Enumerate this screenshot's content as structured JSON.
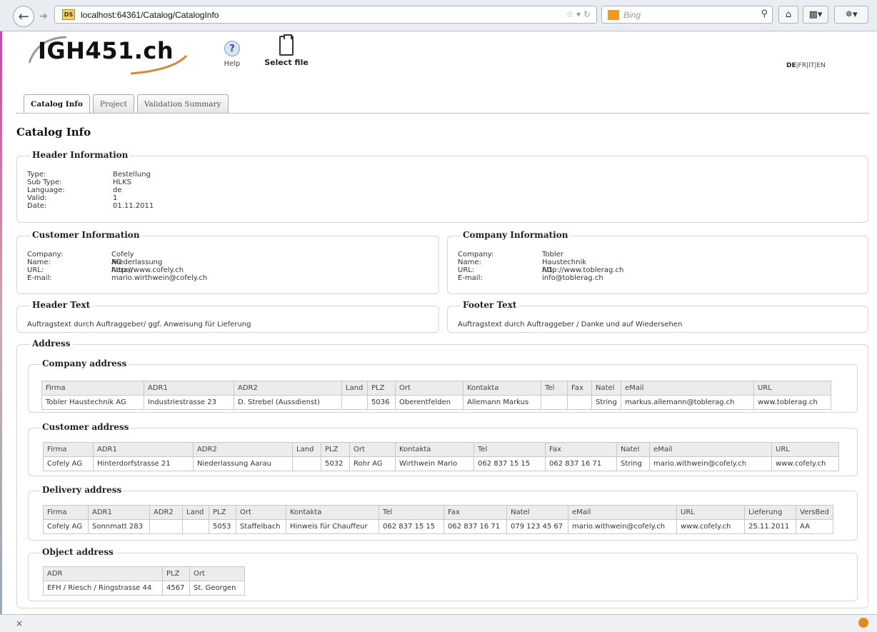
{
  "browser": {
    "url": "localhost:64361/Catalog/CatalogInfo",
    "search_placeholder": "Bing",
    "site_icon_text": "DS",
    "status_close": "×"
  },
  "app": {
    "logo": "IGH451.ch",
    "help_label": "Help",
    "select_file_label": "Select file",
    "languages": [
      "DE",
      "FR",
      "IT",
      "EN"
    ],
    "lang_sep": "|"
  },
  "tabs": [
    {
      "label": "Catalog Info"
    },
    {
      "label": "Project"
    },
    {
      "label": "Validation Summary"
    }
  ],
  "page_title": "Catalog Info",
  "header_info": {
    "title": "Header Information",
    "rows": [
      {
        "k": "Type:",
        "v": "Bestellung"
      },
      {
        "k": "Sub Type:",
        "v": "HLKS"
      },
      {
        "k": "Language:",
        "v": "de"
      },
      {
        "k": "Valid:",
        "v": "1"
      },
      {
        "k": "Date:",
        "v": "01.11.2011"
      }
    ]
  },
  "customer_info": {
    "title": "Customer Information",
    "rows": [
      {
        "k": "Company:",
        "v": "Cofely AG"
      },
      {
        "k": "Name:",
        "v": "Niederlassung Aarau"
      },
      {
        "k": "URL:",
        "v": "http://www.cofely.ch"
      },
      {
        "k": "E-mail:",
        "v": "mario.wirthwein@cofely.ch"
      }
    ]
  },
  "company_info": {
    "title": "Company Information",
    "rows": [
      {
        "k": "Company:",
        "v": "Tobler Haustechnik AG"
      },
      {
        "k": "Name:",
        "v": ""
      },
      {
        "k": "URL:",
        "v": "http://www.toblerag.ch"
      },
      {
        "k": "E-mail:",
        "v": "info@toblerag.ch"
      }
    ]
  },
  "header_text": {
    "title": "Header Text",
    "text": "Auftragstext durch Auftraggeber/ ggf. Anweisung für Lieferung"
  },
  "footer_text": {
    "title": "Footer Text",
    "text": "Auftragstext durch Auftraggeber / Danke und auf Wiedersehen"
  },
  "address": {
    "title": "Address",
    "company": {
      "title": "Company address",
      "headers": [
        "Firma",
        "ADR1",
        "ADR2",
        "Land",
        "PLZ",
        "Ort",
        "Kontakta",
        "Tel",
        "Fax",
        "Natel",
        "eMail",
        "URL"
      ],
      "rows": [
        [
          "Tobler Haustechnik AG",
          "Industriestrasse 23",
          "D. Strebel (Aussdienst)",
          "",
          "5036",
          "Oberentfelden",
          "Allemann Markus",
          "",
          "",
          "String",
          "markus.allemann@toblerag.ch",
          "www.toblerag.ch"
        ]
      ]
    },
    "customer": {
      "title": "Customer address",
      "headers": [
        "Firma",
        "ADR1",
        "ADR2",
        "Land",
        "PLZ",
        "Ort",
        "Kontakta",
        "Tel",
        "Fax",
        "Natel",
        "eMail",
        "URL"
      ],
      "rows": [
        [
          "Cofely AG",
          "Hinterdorfstrasse 21",
          "Niederlassung Aarau",
          "",
          "5032",
          "Rohr AG",
          "Wirthwein Mario",
          "062 837 15 15",
          "062 837 16 71",
          "String",
          "mario.withwein@cofely.ch",
          "www.cofely.ch"
        ]
      ]
    },
    "delivery": {
      "title": "Delivery address",
      "headers": [
        "Firma",
        "ADR1",
        "ADR2",
        "Land",
        "PLZ",
        "Ort",
        "Kontakta",
        "Tel",
        "Fax",
        "Natel",
        "eMail",
        "URL",
        "Lieferung",
        "VersBed"
      ],
      "rows": [
        [
          "Cofely AG",
          "Sonnmatt 283",
          "",
          "",
          "5053",
          "Staffelbach",
          "Hinweis für Chauffeur",
          "062 837 15 15",
          "062 837 16 71",
          "079 123 45 67",
          "mario.withwein@cofely.ch",
          "www.cofely.ch",
          "25.11.2011",
          "AA"
        ]
      ]
    },
    "object": {
      "title": "Object address",
      "headers": [
        "ADR",
        "PLZ",
        "Ort"
      ],
      "rows": [
        [
          "EFH / Riesch / Ringstrasse 44",
          "4567",
          "St. Georgen"
        ]
      ]
    }
  }
}
